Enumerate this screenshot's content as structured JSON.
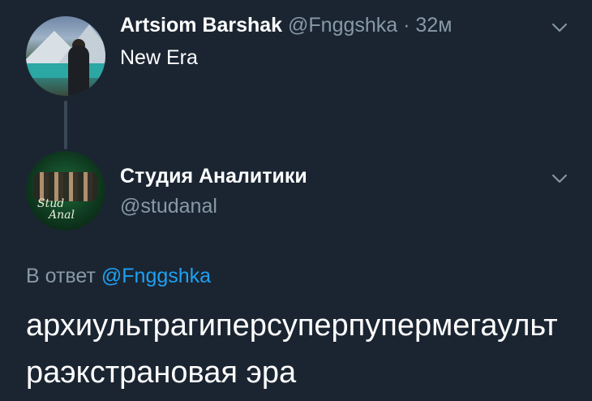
{
  "parent_tweet": {
    "author_name": "Artsiom Barshak",
    "handle": "@Fnggshka",
    "separator": " · ",
    "time": "32м",
    "text": "New Era",
    "menu_icon": "chevron-down-icon"
  },
  "reply_tweet": {
    "author_name": "Студия Аналитики",
    "handle": "@studanal",
    "avatar_text_line1": "Stud",
    "avatar_text_line2": "Anal",
    "menu_icon": "chevron-down-icon",
    "reply_to_prefix": "В ответ",
    "reply_to_handle": "@Fnggshka",
    "text": "архиультрагиперсуперпупермегаультраэкстрановая эра"
  },
  "colors": {
    "background": "#1b2532",
    "secondary_text": "#8899a6",
    "mention": "#1da1f2"
  }
}
